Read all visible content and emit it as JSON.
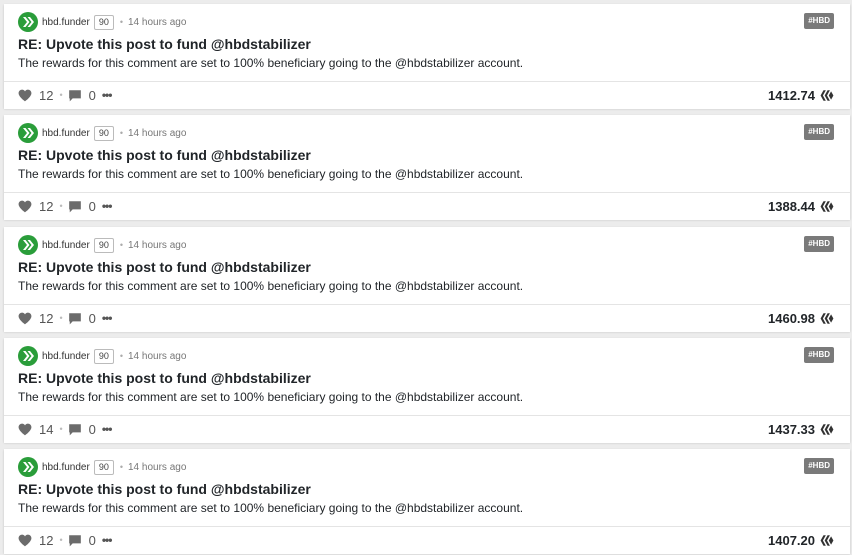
{
  "colors": {
    "accent": "#2a9d3a",
    "tag_bg": "#7a7a7a",
    "card_bg": "#ffffff"
  },
  "posts": [
    {
      "author": "hbd.funder",
      "reputation": "90",
      "time": "14 hours ago",
      "tag": "#HBD",
      "title": "RE: Upvote this post to fund @hbdstabilizer",
      "summary": "The rewards for this comment are set to 100% beneficiary going to the @hbdstabilizer account.",
      "votes": "12",
      "comments": "0",
      "payout": "1412.74"
    },
    {
      "author": "hbd.funder",
      "reputation": "90",
      "time": "14 hours ago",
      "tag": "#HBD",
      "title": "RE: Upvote this post to fund @hbdstabilizer",
      "summary": "The rewards for this comment are set to 100% beneficiary going to the @hbdstabilizer account.",
      "votes": "12",
      "comments": "0",
      "payout": "1388.44"
    },
    {
      "author": "hbd.funder",
      "reputation": "90",
      "time": "14 hours ago",
      "tag": "#HBD",
      "title": "RE: Upvote this post to fund @hbdstabilizer",
      "summary": "The rewards for this comment are set to 100% beneficiary going to the @hbdstabilizer account.",
      "votes": "12",
      "comments": "0",
      "payout": "1460.98"
    },
    {
      "author": "hbd.funder",
      "reputation": "90",
      "time": "14 hours ago",
      "tag": "#HBD",
      "title": "RE: Upvote this post to fund @hbdstabilizer",
      "summary": "The rewards for this comment are set to 100% beneficiary going to the @hbdstabilizer account.",
      "votes": "14",
      "comments": "0",
      "payout": "1437.33"
    },
    {
      "author": "hbd.funder",
      "reputation": "90",
      "time": "14 hours ago",
      "tag": "#HBD",
      "title": "RE: Upvote this post to fund @hbdstabilizer",
      "summary": "The rewards for this comment are set to 100% beneficiary going to the @hbdstabilizer account.",
      "votes": "12",
      "comments": "0",
      "payout": "1407.20"
    }
  ]
}
